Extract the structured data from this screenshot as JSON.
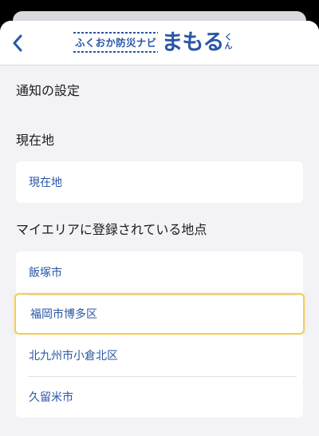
{
  "header": {
    "logo_sub": "ふくおか防災ナビ",
    "logo_main": "まもる",
    "logo_kun": [
      "く",
      "ん"
    ]
  },
  "page_title": "通知の設定",
  "current_location": {
    "header": "現在地",
    "items": [
      {
        "label": "現在地"
      }
    ]
  },
  "my_area": {
    "header": "マイエリアに登録されている地点",
    "items": [
      {
        "label": "飯塚市"
      },
      {
        "label": "福岡市博多区"
      },
      {
        "label": "北九州市小倉北区"
      },
      {
        "label": "久留米市"
      }
    ]
  },
  "colors": {
    "accent": "#2a56a6",
    "focus_ring": "#f1cd5b",
    "background": "#f2f2f7"
  },
  "icons": {
    "back": "chevron-left-icon"
  }
}
